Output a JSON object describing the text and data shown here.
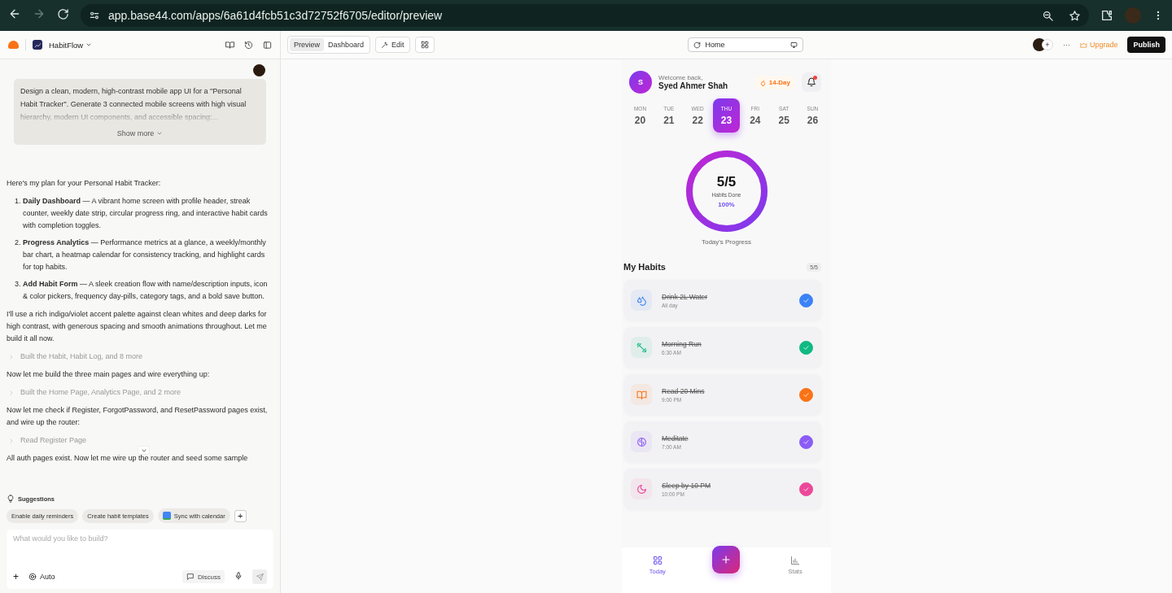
{
  "browser": {
    "url": "app.base44.com/apps/6a61d4fcb51c3d72752f6705/editor/preview"
  },
  "app_header": {
    "project_name": "HabitFlow",
    "view_tabs": [
      {
        "label": "Preview",
        "selected": true
      },
      {
        "label": "Dashboard",
        "selected": false
      }
    ],
    "edit_label": "Edit",
    "page_selector": "Home",
    "add_label": "+",
    "more_label": "···",
    "upgrade_label": "Upgrade",
    "publish_label": "Publish"
  },
  "chat": {
    "prompt": "Design a clean, modern, high-contrast mobile app UI for a \"Personal Habit Tracker\". Generate 3 connected mobile screens with high visual hierarchy, modern UI components, and accessible spacing:...",
    "show_more": "Show more",
    "messages": [
      {
        "kind": "text",
        "text": "Here's my plan for your Personal Habit Tracker:"
      },
      {
        "kind": "list",
        "items": [
          {
            "marker": "1.",
            "text": "**Daily Dashboard** — A vibrant home screen with profile header, streak counter, weekly date strip, circular progress ring, and interactive habit cards with completion toggles."
          },
          {
            "marker": "2.",
            "text": "**Progress Analytics** — Performance metrics at a glance, a weekly/monthly bar chart, a heatmap calendar for consistency tracking, and highlight cards for top habits."
          },
          {
            "marker": "3.",
            "text": "**Add Habit Form** — A sleek creation flow with name/description inputs, icon & color pickers, frequency day-pills, category tags, and a bold save button."
          }
        ]
      },
      {
        "kind": "text",
        "text": "I'll use a rich indigo/violet accent palette against clean whites and deep darks for high contrast, with generous spacing and smooth animations throughout. Let me build it all now."
      },
      {
        "kind": "step",
        "text": "Built the Habit, Habit Log, and 8 more"
      },
      {
        "kind": "text",
        "text": "Now let me build the three main pages and wire everything up:"
      },
      {
        "kind": "step",
        "text": "Built the Home Page, Analytics Page, and 2 more"
      },
      {
        "kind": "text",
        "text": "Now let me check if Register, ForgotPassword, and ResetPassword pages exist, and wire up the router:"
      },
      {
        "kind": "step",
        "text": "Read Register Page"
      },
      {
        "kind": "text",
        "text": "All auth pages exist. Now let me wire up the router and seed some sample"
      }
    ],
    "suggestions_title": "Suggestions",
    "suggestions": [
      {
        "label": "Enable daily reminders",
        "kind": "plain"
      },
      {
        "label": "Create habit templates",
        "kind": "plain"
      },
      {
        "label": "Sync with calendar",
        "kind": "calendar"
      }
    ],
    "add_suggestion": "+",
    "input": {
      "placeholder": "What would you like to build?"
    },
    "attach_label": "+",
    "mode_label": "Auto",
    "discuss_label": "Discuss"
  },
  "app": {
    "greeting": "Welcome back,",
    "user_name": "Syed Ahmer Shah",
    "avatar_letter": "S",
    "streak": "14-Day",
    "days": [
      {
        "dow": "MON",
        "date": "20",
        "selected": false
      },
      {
        "dow": "TUE",
        "date": "21",
        "selected": false
      },
      {
        "dow": "WED",
        "date": "22",
        "selected": false
      },
      {
        "dow": "THU",
        "date": "23",
        "selected": true
      },
      {
        "dow": "FRI",
        "date": "24",
        "selected": false
      },
      {
        "dow": "SAT",
        "date": "25",
        "selected": false
      },
      {
        "dow": "SUN",
        "date": "26",
        "selected": false
      }
    ],
    "progress": {
      "count": "5/5",
      "caption": "Habits Done",
      "percent": "100%",
      "level": 1,
      "label": "Today's Progress"
    },
    "habits_title": "My Habits",
    "habits_count": "5/5",
    "habits": [
      {
        "name": "Drink 2L Water",
        "time": "All day",
        "done": true,
        "color": "#3b82f6"
      },
      {
        "name": "Morning Run",
        "time": "6:30 AM",
        "done": true,
        "color": "#10b981"
      },
      {
        "name": "Read 20 Mins",
        "time": "9:00 PM",
        "done": true,
        "color": "#f97316"
      },
      {
        "name": "Meditate",
        "time": "7:00 AM",
        "done": true,
        "color": "#8b5cf6"
      },
      {
        "name": "Sleep by 10 PM",
        "time": "10:00 PM",
        "done": true,
        "color": "#ec4899"
      }
    ],
    "nav": [
      {
        "label": "Today",
        "selected": true
      },
      {
        "label": "Stats",
        "selected": false
      }
    ]
  }
}
